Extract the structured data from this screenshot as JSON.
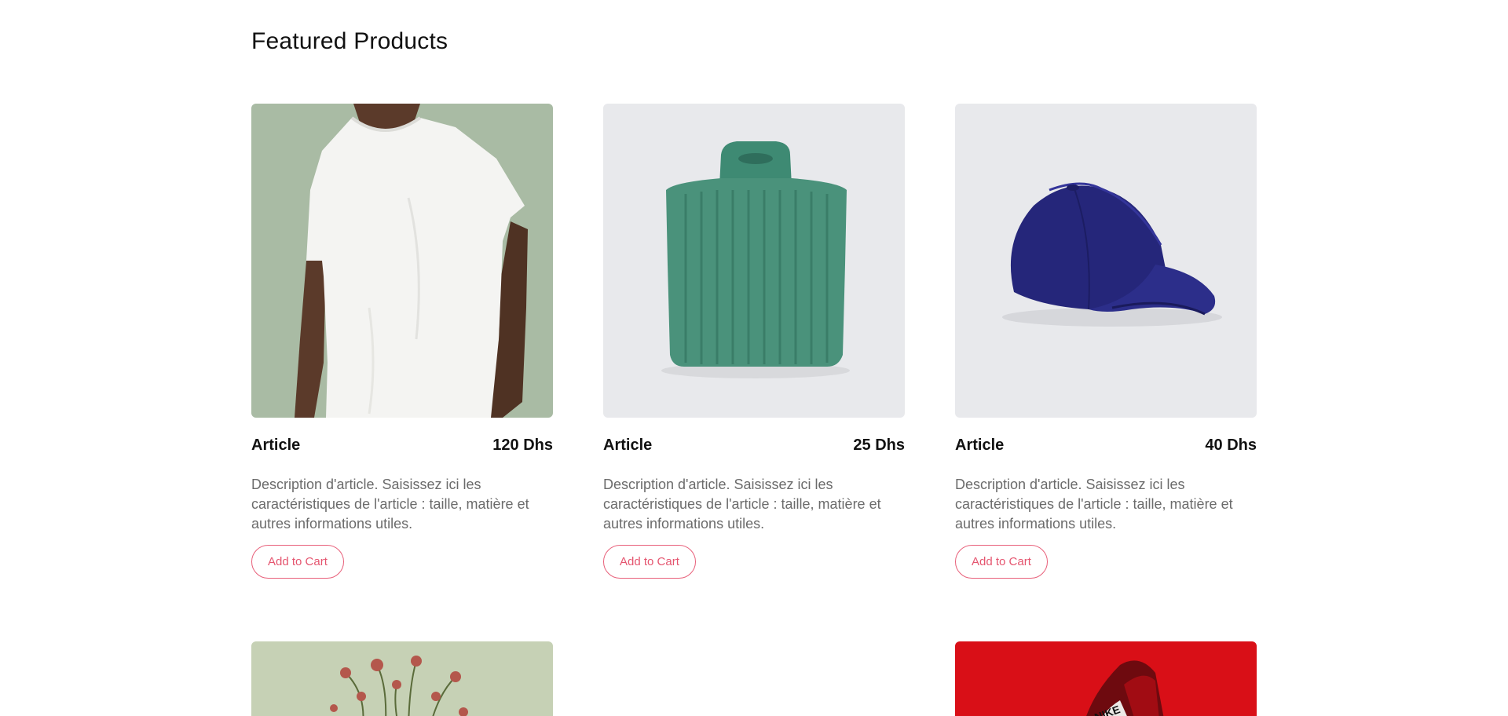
{
  "section": {
    "title": "Featured Products"
  },
  "products": [
    {
      "name": "Article",
      "price": "120 Dhs",
      "description": "Description d'article. Saisissez ici les caractéristiques de l'article : taille, matière et autres informations utiles.",
      "button": "Add to Cart",
      "image": "white-tshirt-model"
    },
    {
      "name": "Article",
      "price": "25 Dhs",
      "description": "Description d'article. Saisissez ici les caractéristiques de l'article : taille, matière et autres informations utiles.",
      "button": "Add to Cart",
      "image": "green-knit-sweater"
    },
    {
      "name": "Article",
      "price": "40 Dhs",
      "description": "Description d'article. Saisissez ici les caractéristiques de l'article : taille, matière et autres informations utiles.",
      "button": "Add to Cart",
      "image": "navy-baseball-cap"
    }
  ],
  "second_row_images": [
    "dried-flowers",
    "",
    "red-sneaker"
  ],
  "colors": {
    "accent": "#e5556f",
    "tshirt_bg": "#a9bba4",
    "sweater_bg": "#e8e9ec",
    "cap_bg": "#e8e9ec",
    "flowers_bg": "#c6d1b5",
    "sneaker_bg": "#d90f17"
  }
}
